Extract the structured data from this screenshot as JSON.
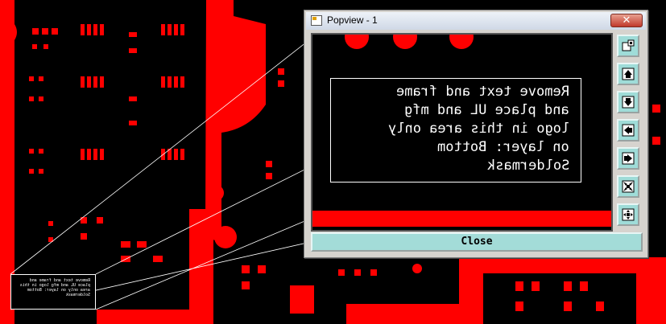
{
  "popup": {
    "title": "Popview - 1",
    "close_glyph": "✕",
    "close_button_label": "Close",
    "note_lines": [
      "Remove text and frame",
      "and place UL and mfg",
      "logo in this area only",
      "on layer: Bottom",
      "Soldermask"
    ],
    "toolbar_icons": [
      "fit-view-icon",
      "pan-up-icon",
      "pan-down-icon",
      "pan-left-icon",
      "pan-right-icon",
      "zoom-in-icon",
      "zoom-out-icon"
    ]
  },
  "board_note_thumbnail": "Remove text and frame and place UL and mfg logo in this area only on layer: Bottom Soldermask",
  "colors": {
    "copper": "#ff0000",
    "background": "#000000",
    "button": "#a3dcd8"
  }
}
